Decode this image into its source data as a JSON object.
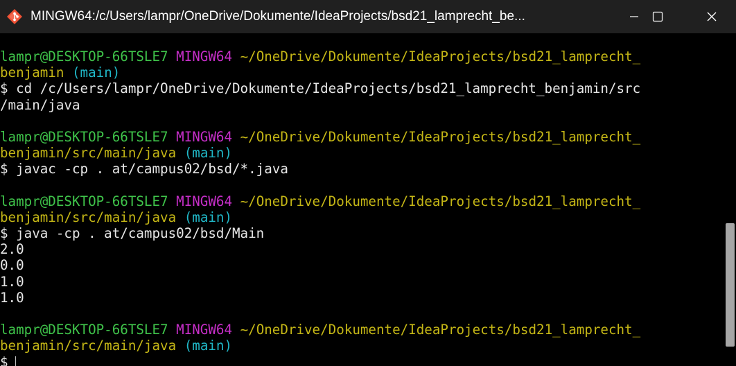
{
  "window": {
    "title": "MINGW64:/c/Users/lampr/OneDrive/Dokumente/IdeaProjects/bsd21_lamprecht_be...",
    "icon": "git-bash-icon",
    "controls": {
      "minimize": "minimize-icon",
      "maximize": "maximize-icon",
      "close": "close-icon"
    }
  },
  "colors": {
    "background": "#000000",
    "titlebar": "#202020",
    "prompt_user": "#3fc34a",
    "prompt_shell": "#c62ec8",
    "prompt_path": "#c4b616",
    "prompt_branch": "#20b8c8",
    "output_text": "#e6e6e6"
  },
  "terminal": {
    "blocks": [
      {
        "user": "lampr@DESKTOP-66TSLE7",
        "shell": "MINGW64",
        "path_line1": "~/OneDrive/Dokumente/IdeaProjects/bsd21_lamprecht_",
        "path_line2": "benjamin",
        "branch": "(main)",
        "command_line1": "$ cd /c/Users/lampr/OneDrive/Dokumente/IdeaProjects/bsd21_lamprecht_benjamin/src",
        "command_line2": "/main/java",
        "output": []
      },
      {
        "user": "lampr@DESKTOP-66TSLE7",
        "shell": "MINGW64",
        "path_line1": "~/OneDrive/Dokumente/IdeaProjects/bsd21_lamprecht_",
        "path_line2": "benjamin/src/main/java",
        "branch": "(main)",
        "command_line1": "$ javac -cp . at/campus02/bsd/*.java",
        "output": []
      },
      {
        "user": "lampr@DESKTOP-66TSLE7",
        "shell": "MINGW64",
        "path_line1": "~/OneDrive/Dokumente/IdeaProjects/bsd21_lamprecht_",
        "path_line2": "benjamin/src/main/java",
        "branch": "(main)",
        "command_line1": "$ java -cp . at/campus02/bsd/Main",
        "output": [
          "2.0",
          "0.0",
          "1.0",
          "1.0"
        ]
      },
      {
        "user": "lampr@DESKTOP-66TSLE7",
        "shell": "MINGW64",
        "path_line1": "~/OneDrive/Dokumente/IdeaProjects/bsd21_lamprecht_",
        "path_line2": "benjamin/src/main/java",
        "branch": "(main)",
        "command_line1": "$"
      }
    ]
  }
}
